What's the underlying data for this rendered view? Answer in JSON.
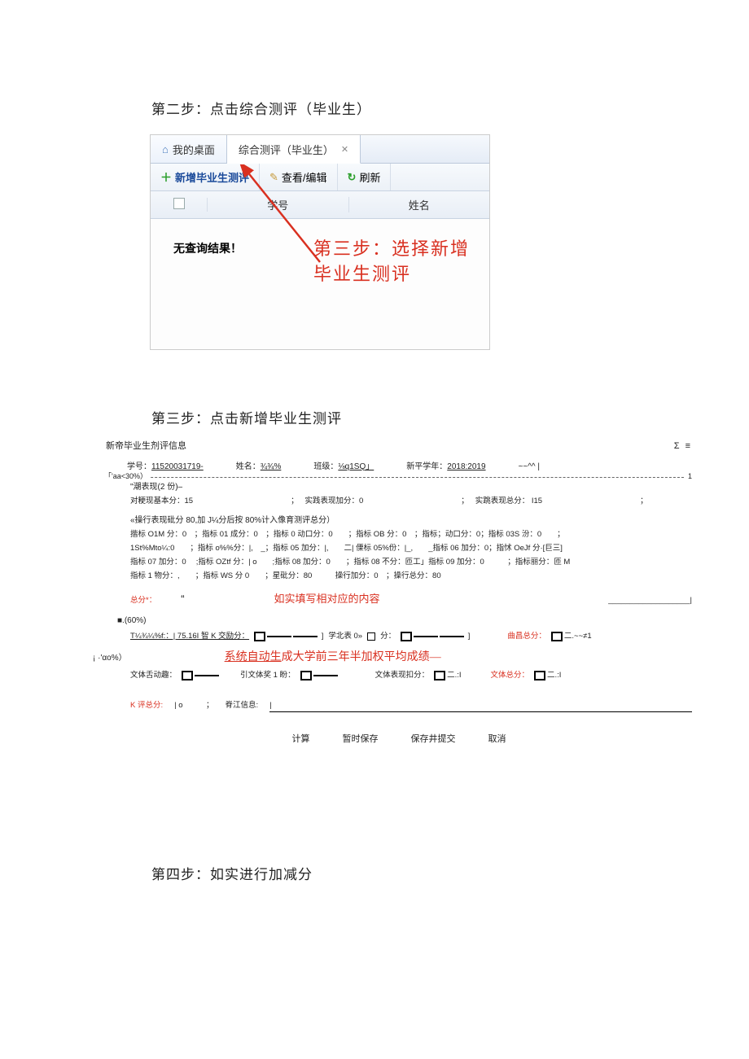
{
  "step2_title": "第二步：点击综合测评（毕业生）",
  "step3_title": "第三步：点击新增毕业生测评",
  "step4_title": "第四步：如实进行加减分",
  "panel1": {
    "tab_home": "我的桌面",
    "tab_eval": "综合测评（毕业生）",
    "btn_add": "新增毕业生测评",
    "btn_edit": "查看/编辑",
    "btn_refresh": "刷新",
    "header_xh": "学号",
    "header_name": "姓名",
    "no_result": "无查询结果！",
    "annotation": "第三步：选择新增\n毕业生测评"
  },
  "panel2": {
    "title": "新帝毕业生剂评信息",
    "icons_right": "Σ ≡",
    "info": {
      "xh_label": "学号：",
      "xh_value": "11520031719-",
      "name_label": "姓名：",
      "name_value": "¾¾%",
      "class_label": "班级：",
      "class_value": "⅛q1SQ」",
      "year_label": "新平学年：",
      "year_value": "2018:2019",
      "tail": "~~^^ |"
    },
    "section1_label": "「'aa<30%）",
    "section1_tail": "1",
    "sec1_line1": "\"潮表现(2 份)–",
    "sec1_row": {
      "a": "对粳现基本分：15",
      "b": "实践表现加分：0",
      "c": "实跳表现总分： I15"
    },
    "sec1_line2": "«操行表现砒分 80,加 J¼分后按 80%计入像育测评总分）",
    "grid": {
      "r1": "揩标 O1M 分：0 ；指标 01 成分：0 ；指标 0 动口分：0  ；指标 OB 分：0 ；指标；动口分：0；指标 03S 汾：0  ；",
      "r2": "1St%Mto¼:0  ；指标 o%%分：|, _；指标 05 加分：|,  二| 傈标 05%份：|_,  _指标 06 加分：0；指怵 OeJf 分·[巨三]",
      "r3": "指标 07 加分：0  ;指标 OZtf 分：| o  ;指标 08 加分：0  ；指标 08 不分：匝工」指标 09 加分：0   ；指标丽分：匝 M",
      "r4": "指标 1 物分：,  ；指标 WS 分 0  ；星砒分：80   操行加分：0 ；操行总分：80"
    },
    "totals_label": "总分*：",
    "totals_quote": "“",
    "red_note1": "如实填写相对应的内容",
    "sec2_label": "■.(60%)",
    "sec2_line_a": "T¼¾¼%f:：| 75.16I 智 K 交励分：",
    "sec2_line_b": "学北表 0»",
    "sec2_line_c": "分：",
    "sec2_line_d": "曲昌总分：",
    "sec2_line_e": "二.~~≠1",
    "sec3_label": "¡ ·'αο%）",
    "red_note2_a": "系统自动生",
    "red_note2_b": "成大学前三年半加权平均成绩—",
    "sec3_items": {
      "a": "文体舌动趣：",
      "b": "引文体奖 1 盼：",
      "c": "文体表现扣分：",
      "d": "文体总分：",
      "suffix": "二.:I"
    },
    "final_row": {
      "a_label": "K 评总分:",
      "a_val": "| o   ；",
      "b_label": "脊江信息:",
      "b_val": "|"
    },
    "buttons": {
      "calc": "计算",
      "save": "暂时保存",
      "submit": "保存井提交",
      "cancel": "取消"
    }
  }
}
